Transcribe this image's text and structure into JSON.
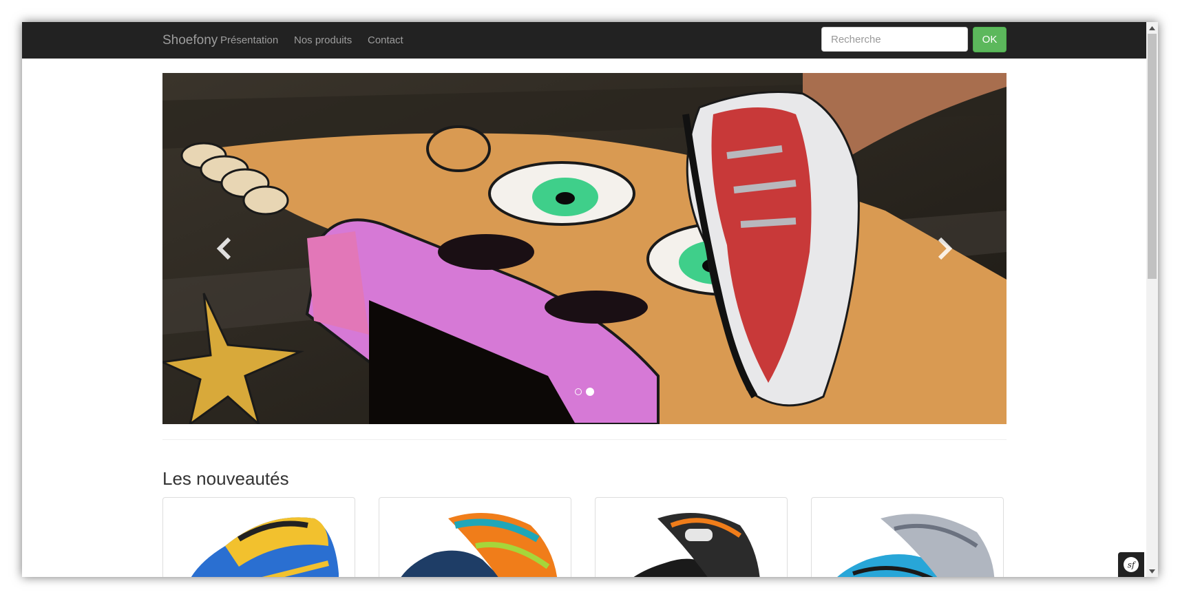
{
  "navbar": {
    "brand": "Shoefony",
    "links": [
      "Présentation",
      "Nos produits",
      "Contact"
    ],
    "search": {
      "placeholder": "Recherche",
      "value": ""
    },
    "ok_label": "OK"
  },
  "carousel": {
    "slide_count": 2,
    "active_slide": 2,
    "prev_icon": "chevron-left-icon",
    "next_icon": "chevron-right-icon"
  },
  "section": {
    "title": "Les nouveautés"
  },
  "products": [
    {
      "icon": "sneaker-image",
      "colors": [
        "#f2c12e",
        "#2a6fd1"
      ]
    },
    {
      "icon": "sneaker-image",
      "colors": [
        "#f07d1a",
        "#1fa6b8"
      ]
    },
    {
      "icon": "sneaker-image",
      "colors": [
        "#222222",
        "#f07d1a"
      ]
    },
    {
      "icon": "sneaker-image",
      "colors": [
        "#28a6d8",
        "#b0b6c0"
      ]
    }
  ],
  "colors": {
    "navbar_bg": "#222222",
    "nav_text": "#9d9d9d",
    "ok_button": "#5cb85c"
  },
  "symfony_toolbar": {
    "icon": "symfony-logo-icon"
  }
}
